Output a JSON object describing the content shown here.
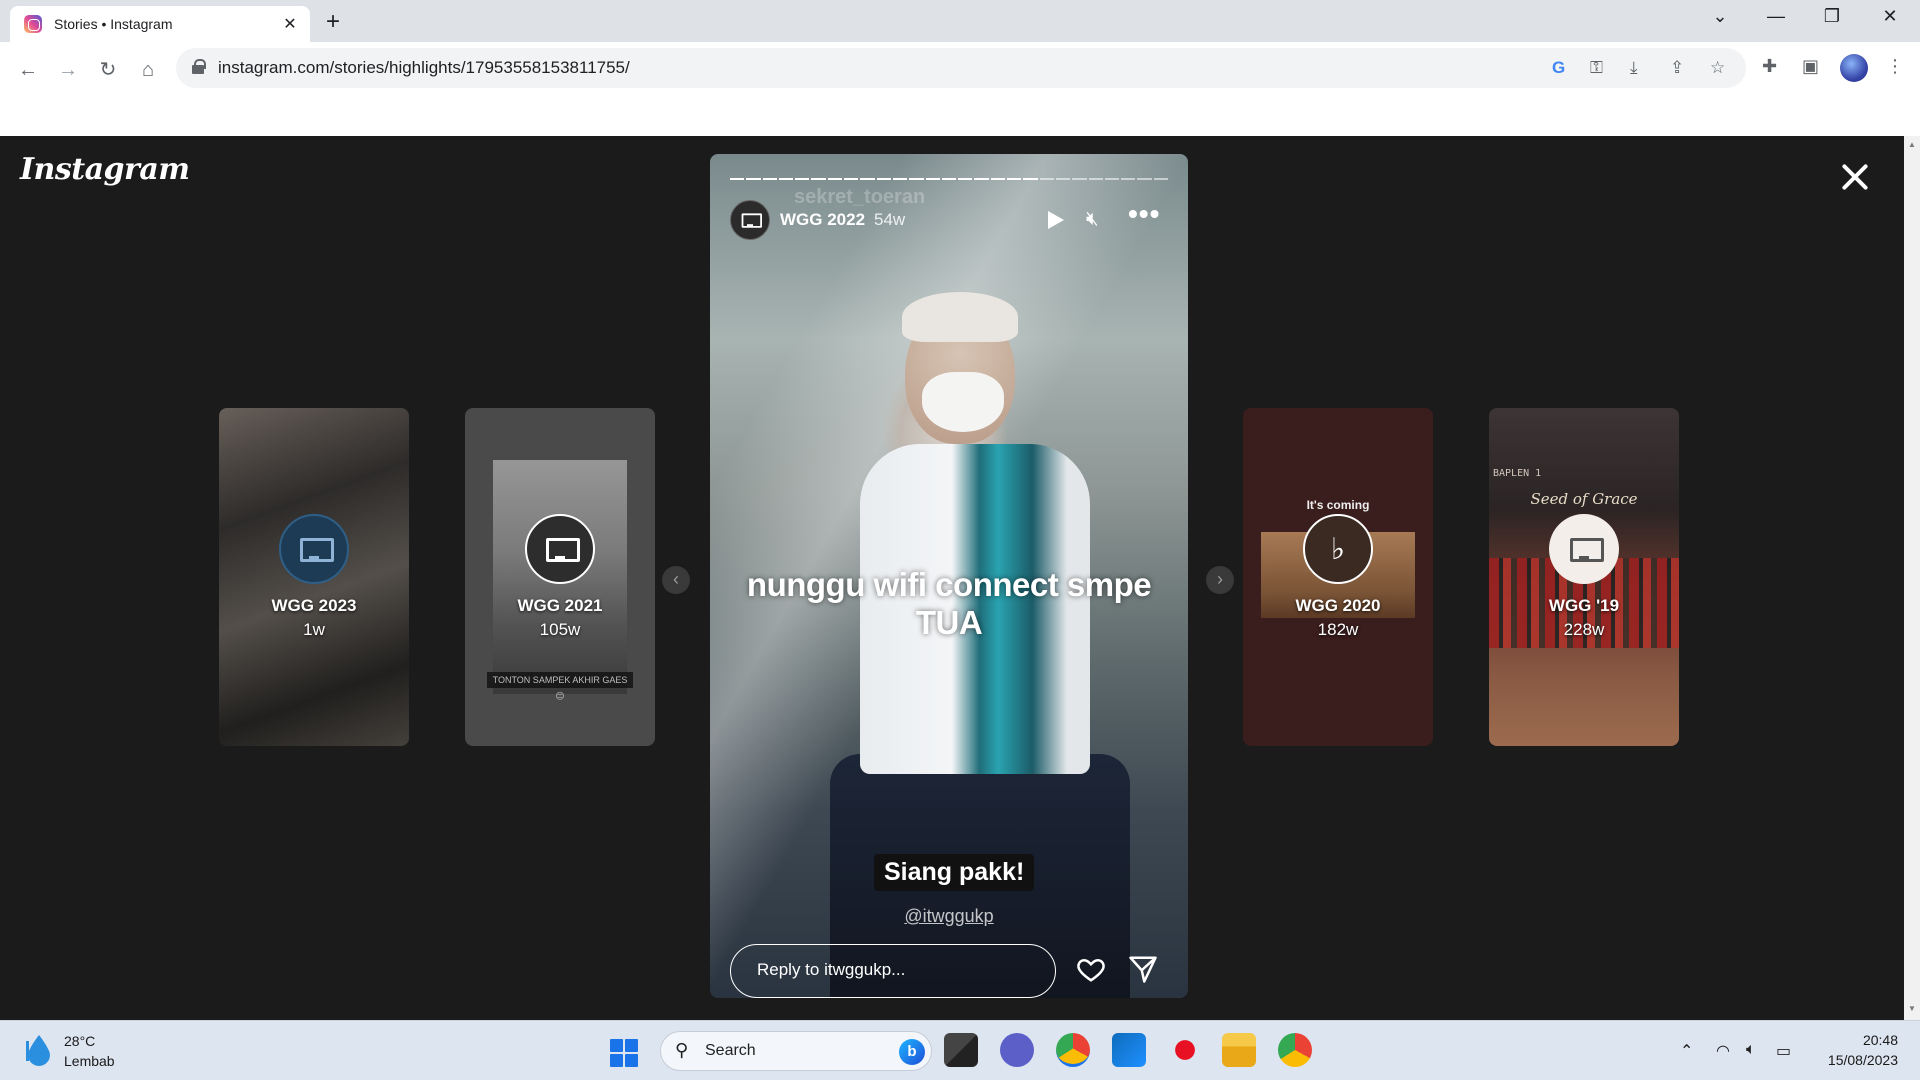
{
  "browser": {
    "tab_title": "Stories • Instagram",
    "tab_close": "✕",
    "new_tab": "+",
    "url": "instagram.com/stories/highlights/17953558153811755/",
    "window_controls": {
      "dropdown": "⌄",
      "minimize": "—",
      "restore": "❐",
      "close": "✕"
    },
    "nav": {
      "back": "←",
      "forward": "→",
      "reload": "↻",
      "home": "⌂"
    }
  },
  "instagram": {
    "logo": "Instagram",
    "prev_arrow": "‹",
    "next_arrow": "›",
    "highlights": [
      {
        "title": "WGG 2023",
        "age": "1w"
      },
      {
        "title": "WGG 2021",
        "age": "105w",
        "overlay": "TONTON SAMPEK AKHIR GAES 😊"
      },
      {
        "title": "WGG 2020",
        "age": "182w",
        "overlay": "It's coming"
      },
      {
        "title": "WGG '19",
        "age": "228w",
        "overlay": "Seed of Grace",
        "overlay2": "BAPLEN 1"
      }
    ],
    "story": {
      "ghost_username": "sekret_toeran",
      "title": "WGG 2022",
      "age": "54w",
      "more": "•••",
      "caption": "nunggu wifi connect smpe TUA",
      "sticker": "Siang pakk!",
      "mention": "@itwggukp",
      "reply_placeholder": "Reply to itwggukp...",
      "segments_total": 27,
      "segments_done": 19
    }
  },
  "taskbar": {
    "temperature": "28°C",
    "weather": "Lembab",
    "search_label": "Search",
    "bing": "b",
    "time": "20:48",
    "date": "15/08/2023"
  },
  "colors": {
    "stage_bg": "#1b1b1b",
    "taskbar_bg": "#dde5f0",
    "chrome_tabbar": "#dee1e6"
  }
}
